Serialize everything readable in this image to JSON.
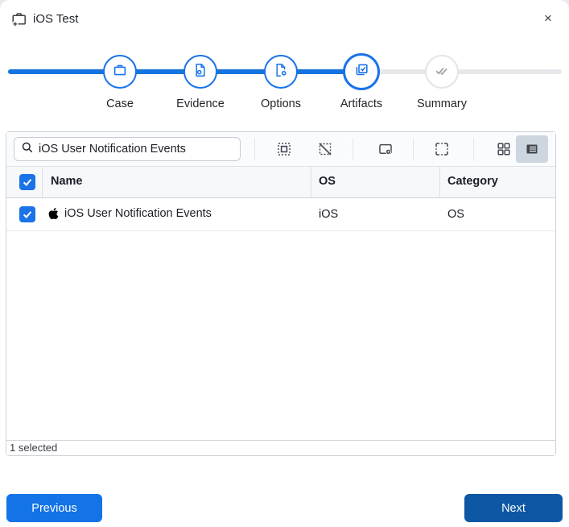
{
  "dialog": {
    "title": "iOS Test",
    "title_icon": "case-add-icon",
    "close_icon": "×"
  },
  "stepper": {
    "accent_color": "#1a73e8",
    "inactive_color": "#e6e8eb",
    "steps": [
      {
        "label": "Case",
        "icon": "briefcase-icon",
        "state": "complete"
      },
      {
        "label": "Evidence",
        "icon": "evidence-file-icon",
        "state": "complete"
      },
      {
        "label": "Options",
        "icon": "file-gear-icon",
        "state": "complete"
      },
      {
        "label": "Artifacts",
        "icon": "artifact-check-icon",
        "state": "active"
      },
      {
        "label": "Summary",
        "icon": "double-check-icon",
        "state": "upcoming"
      }
    ]
  },
  "toolbar": {
    "search": {
      "value": "iOS User Notification Events",
      "icon": "search-icon"
    },
    "buttons": [
      {
        "name": "select-all-icon",
        "active": false
      },
      {
        "name": "deselect-all-icon",
        "active": false
      },
      {
        "name": "profile-settings-icon",
        "active": false
      },
      {
        "name": "custom-selection-icon",
        "active": false
      },
      {
        "name": "grid-view-icon",
        "active": false
      },
      {
        "name": "list-view-icon",
        "active": true
      }
    ]
  },
  "table": {
    "select_all_checked": true,
    "columns": [
      {
        "label": "Name"
      },
      {
        "label": "OS"
      },
      {
        "label": "Category"
      }
    ],
    "rows": [
      {
        "checked": true,
        "icon": "apple-icon",
        "name": "iOS User Notification Events",
        "os": "iOS",
        "category": "OS"
      }
    ],
    "status": "1 selected"
  },
  "footer": {
    "previous_label": "Previous",
    "next_label": "Next",
    "previous_color": "#1473e6",
    "next_color": "#0d57a5"
  },
  "colors": {
    "accent": "#1a73e8",
    "checkbox": "#1a73e8",
    "toolbar_selected_bg": "#cdd5df",
    "header_row_bg": "#f7f8fa"
  }
}
